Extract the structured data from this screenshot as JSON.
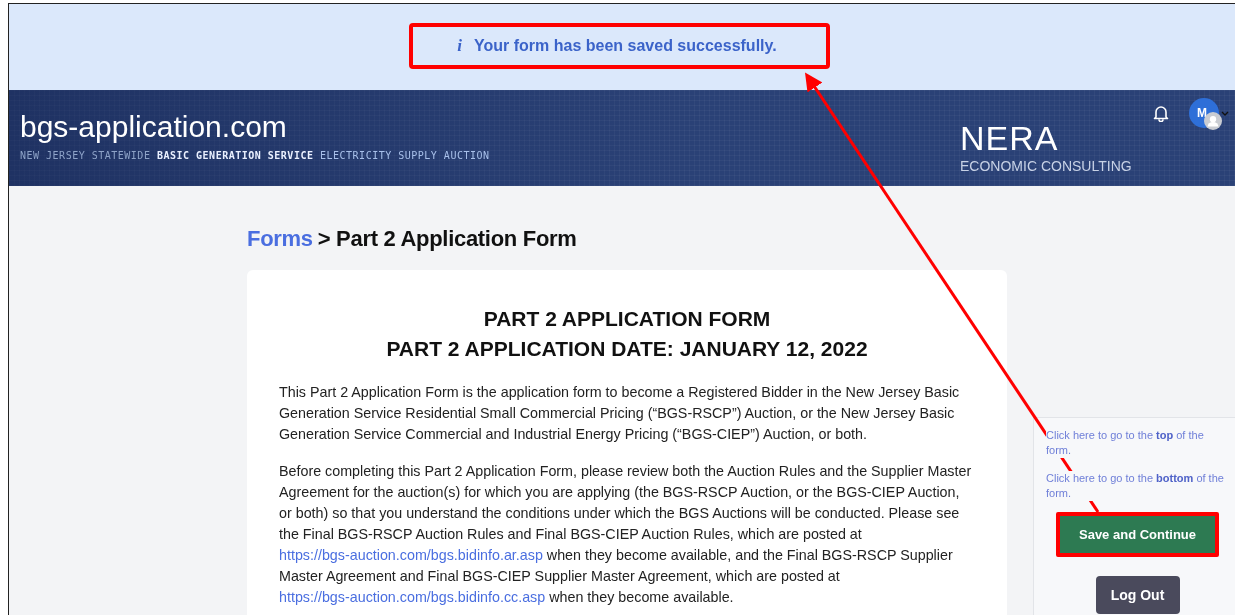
{
  "notice": {
    "icon_text": "i",
    "message": "Your form has been saved successfully."
  },
  "header": {
    "site_title": "bgs-application.com",
    "tagline": [
      {
        "kind": "muted",
        "text": "NEW JERSEY STATEWIDE"
      },
      {
        "kind": "strong",
        "text": "BASIC GENERATION SERVICE"
      },
      {
        "kind": "light",
        "text": "ELECTRICITY SUPPLY AUCTION"
      }
    ],
    "brand": "NERA",
    "brand_sub": "ECONOMIC CONSULTING",
    "avatar_initial": "M"
  },
  "breadcrumb": {
    "link": "Forms",
    "current": "> Part 2 Application Form"
  },
  "form": {
    "title_lines": [
      "PART 2 APPLICATION FORM",
      "PART 2 APPLICATION DATE: JANUARY 12, 2022"
    ],
    "paragraphs": [
      [
        {
          "kind": "text",
          "text": "This Part 2 Application Form is the application form to become a Registered Bidder in the New Jersey Basic Generation Service Residential Small Commercial Pricing (“BGS-RSCP”) Auction, or the New Jersey Basic Generation Service Commercial and Industrial Energy Pricing (“BGS-CIEP”) Auction, or both."
        }
      ],
      [
        {
          "kind": "text",
          "text": "Before completing this Part 2 Application Form, please review both the Auction Rules and the Supplier Master Agreement for the auction(s) for which you are applying (the BGS-RSCP Auction, or the BGS-CIEP Auction, or both) so that you understand the conditions under which the BGS Auctions will be conducted. Please see the Final BGS-RSCP Auction Rules and Final BGS-CIEP Auction Rules, which are posted at "
        },
        {
          "kind": "link",
          "text": "https://bgs-auction.com/bgs.bidinfo.ar.asp"
        },
        {
          "kind": "text",
          "text": " when they become available, and the Final BGS-RSCP Supplier Master Agreement and Final BGS-CIEP Supplier Master Agreement, which are posted at "
        },
        {
          "kind": "link",
          "text": "https://bgs-auction.com/bgs.bidinfo.cc.asp"
        },
        {
          "kind": "text",
          "text": " when they become available."
        }
      ]
    ]
  },
  "side_panel": {
    "links": [
      "Click here to go to the **top** of the form.",
      "Click here to go to the **bottom** of the form."
    ],
    "buttons": [
      {
        "kind": "primary",
        "label": "Save and Continue",
        "highlighted": true
      },
      {
        "kind": "secondary",
        "label": "Log Out",
        "highlighted": false
      }
    ]
  }
}
